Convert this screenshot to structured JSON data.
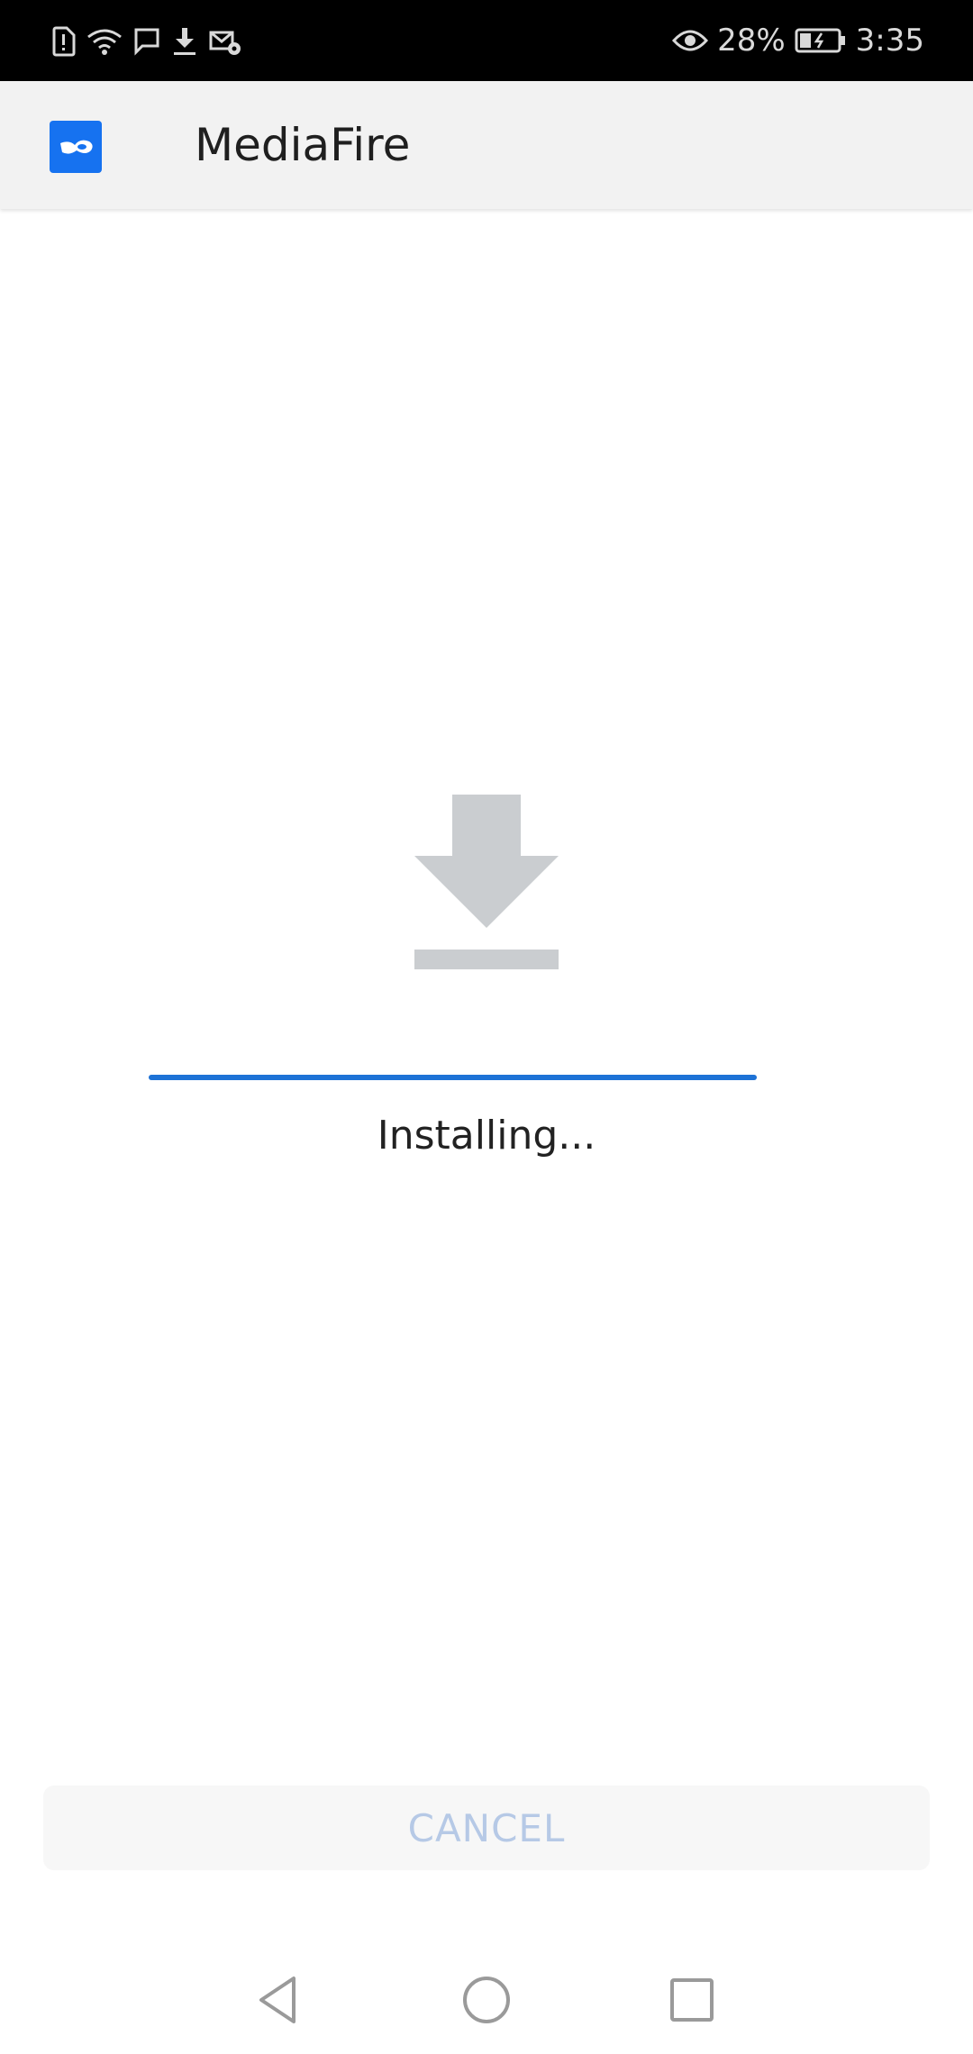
{
  "status_bar": {
    "battery_percent": "28%",
    "time": "3:35",
    "icons": [
      "sim-alert-icon",
      "wifi-icon",
      "chat-icon",
      "download-icon",
      "mail-settings-icon",
      "eye-icon",
      "battery-icon"
    ]
  },
  "app_bar": {
    "title": "MediaFire",
    "logo_icon": "mediafire-logo-icon"
  },
  "main": {
    "icon": "download-arrow-icon",
    "progress": 1.0,
    "status_text": "Installing..."
  },
  "actions": {
    "cancel_label": "CANCEL"
  },
  "nav_bar": {
    "buttons": [
      "back-icon",
      "home-icon",
      "recents-icon"
    ]
  },
  "colors": {
    "accent": "#1d72d6",
    "logo_bg": "#1672f0",
    "icon_gray": "#cacdd0",
    "cancel_text": "#b6c9e6"
  }
}
